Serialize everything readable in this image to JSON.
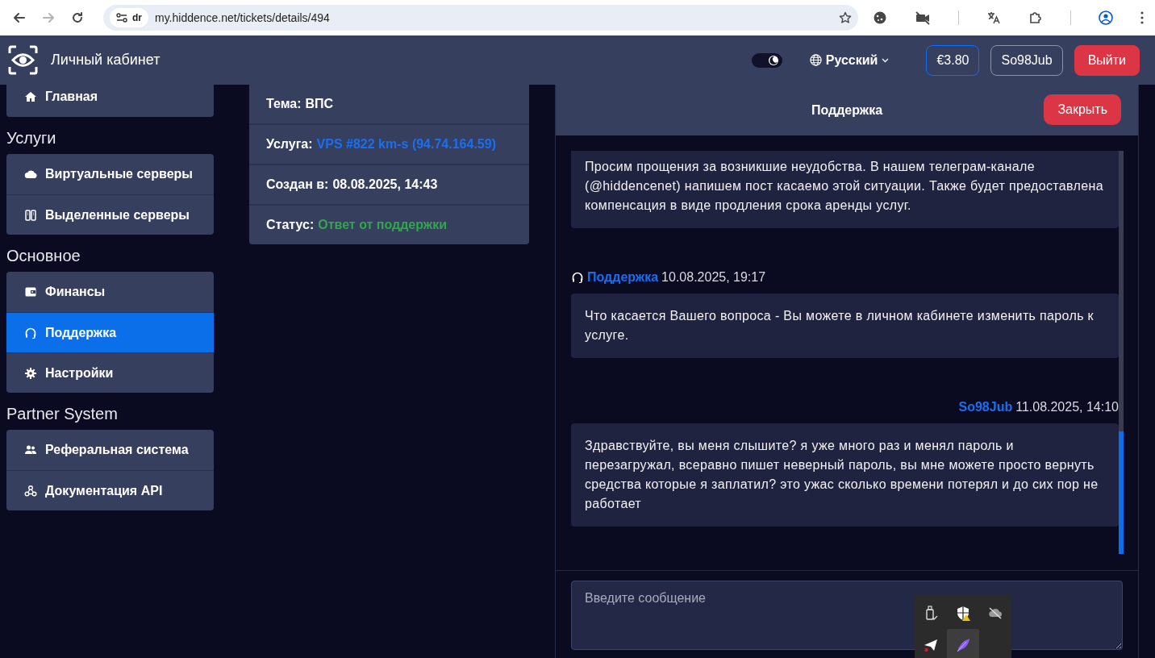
{
  "browser": {
    "chip": "dr",
    "url": "my.hiddence.net/tickets/details/494",
    "back_disabled": false,
    "forward_disabled": true
  },
  "header": {
    "brand": "Личный кабинет",
    "dark_theme": true,
    "language": "Русский",
    "balance": "€3.80",
    "username": "So98Jub",
    "logout": "Выйти"
  },
  "sidebar": {
    "top_items": [
      {
        "label": "Главная",
        "selected": false
      }
    ],
    "sections": [
      {
        "title": "Услуги",
        "items": [
          {
            "label": "Виртуальные серверы",
            "selected": false
          },
          {
            "label": "Выделенные серверы",
            "selected": false
          }
        ]
      },
      {
        "title": "Основное",
        "items": [
          {
            "label": "Финансы",
            "selected": false
          },
          {
            "label": "Поддержка",
            "selected": true
          },
          {
            "label": "Настройки",
            "selected": false
          }
        ]
      },
      {
        "title": "Partner System",
        "items": [
          {
            "label": "Реферальная система",
            "selected": false
          },
          {
            "label": "Документация API",
            "selected": false
          }
        ]
      }
    ]
  },
  "ticket": {
    "rows": [
      {
        "label": "Тема:",
        "value": "ВПС",
        "kind": "plain"
      },
      {
        "label": "Услуга:",
        "value": "VPS #822 km-s (94.74.164.59)",
        "kind": "link"
      },
      {
        "label": "Создан в:",
        "value": "08.08.2025, 14:43",
        "kind": "plain"
      },
      {
        "label": "Статус:",
        "value": "Ответ от поддержки",
        "kind": "status"
      }
    ]
  },
  "chat": {
    "title": "Поддержка",
    "close": "Закрыть",
    "messages": [
      {
        "kind": "incoming",
        "text": "Просим прощения за возникшие неудобства. В нашем телеграм-канале (@hiddencenet) напишем пост касаемо этой ситуации. Также будет предоставлена компенсация в виде продления срока аренды услуг."
      },
      {
        "kind": "incoming",
        "author": "Поддержка",
        "time": "10.08.2025, 19:17",
        "text": "Что касается Вашего вопроса - Вы можете в личном кабинете изменить пароль к услуге."
      },
      {
        "kind": "outgoing",
        "author": "So98Jub",
        "time": "11.08.2025, 14:10",
        "text": "Здравствуйте, вы меня слышите? я уже много раз и менял пароль и перезагружал, всеравно пишет неверный пароль, вы мне можете просто вернуть средства которые я заплатил? это ужас сколько времени потерял и до сих пор не работает"
      }
    ],
    "input": {
      "placeholder": "Введите сообщение"
    }
  },
  "tray": {
    "items": [
      {
        "kind": "usb",
        "selected": false
      },
      {
        "kind": "shield",
        "selected": false
      },
      {
        "kind": "cloud-off",
        "selected": false
      },
      {
        "kind": "plane",
        "selected": false
      },
      {
        "kind": "feather",
        "selected": true
      }
    ]
  }
}
